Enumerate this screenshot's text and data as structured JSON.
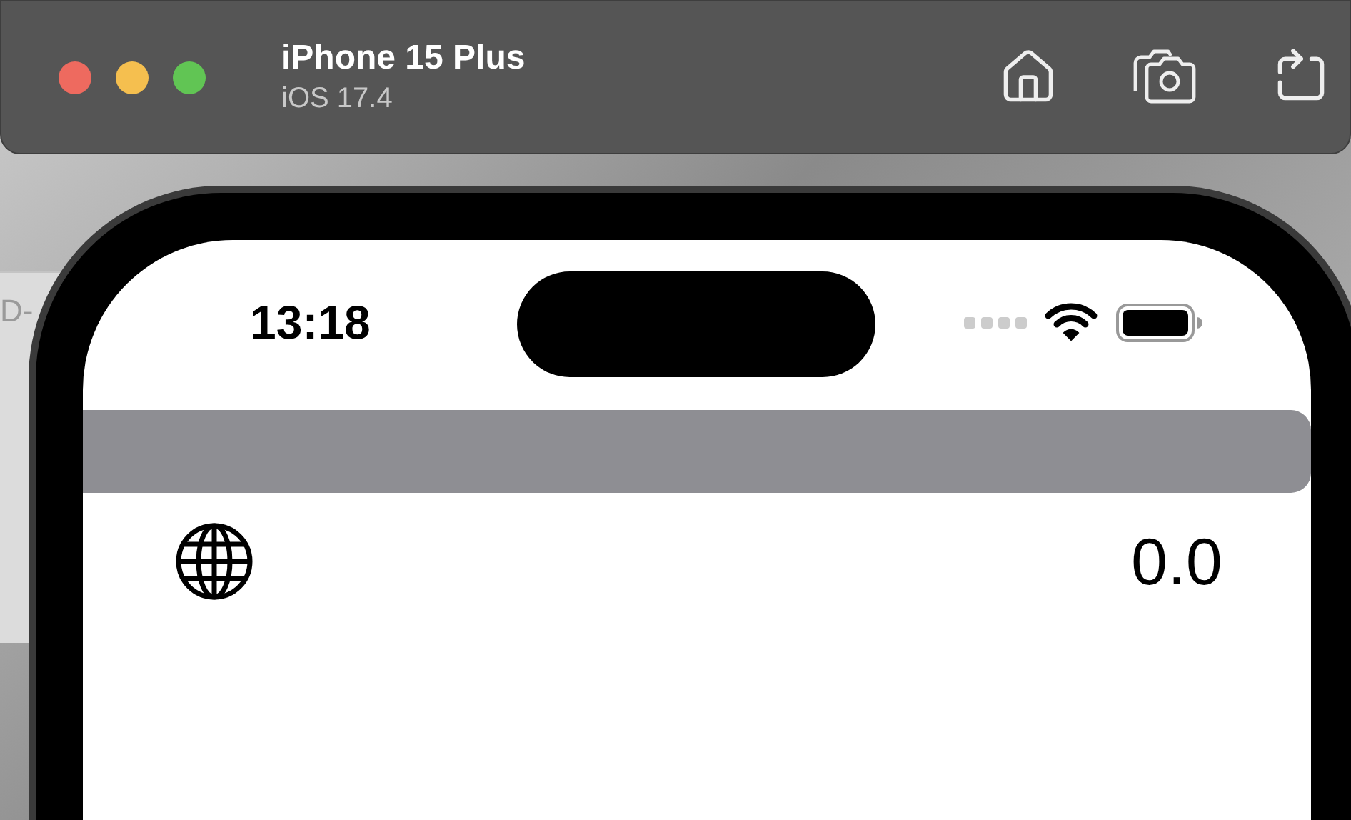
{
  "window": {
    "title": "iPhone 15 Plus",
    "subtitle": "iOS 17.4"
  },
  "background_window": {
    "text": "D-"
  },
  "status_bar": {
    "time": "13:18"
  },
  "content": {
    "value": "0.0"
  }
}
